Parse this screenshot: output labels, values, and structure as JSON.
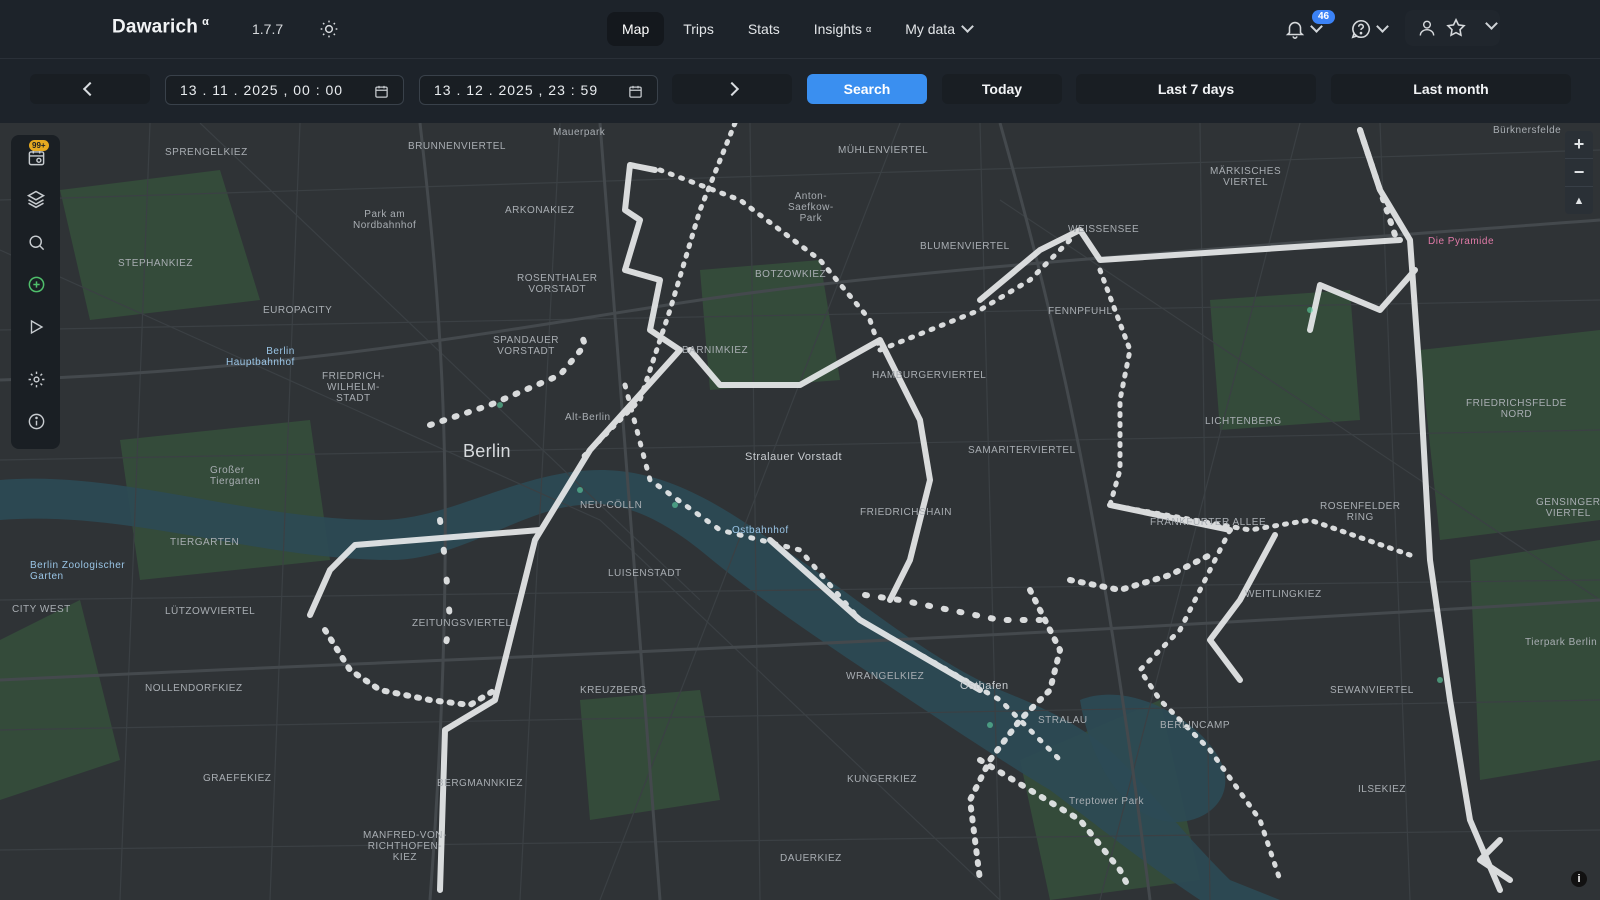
{
  "header": {
    "brand": "Dawarich",
    "brand_sup": "α",
    "version": "1.7.7",
    "nav": [
      {
        "label": "Map",
        "active": true
      },
      {
        "label": "Trips"
      },
      {
        "label": "Stats"
      },
      {
        "label": "Insights",
        "sup": "α"
      },
      {
        "label": "My data",
        "dropdown": true
      }
    ],
    "notifications_count": "46",
    "icons": [
      "sun-icon",
      "bell-icon",
      "help-icon",
      "user-icon",
      "star-icon"
    ]
  },
  "toolbar": {
    "start_datetime": "13 . 11 . 2025 ,  00 : 00",
    "end_datetime": "13 . 12 . 2025 ,  23 : 59",
    "search_label": "Search",
    "today_label": "Today",
    "last7_label": "Last 7 days",
    "lastmonth_label": "Last month"
  },
  "sidebar": {
    "badge": "99+",
    "icons": [
      "calendar-icon",
      "layers-icon",
      "search-icon",
      "add-circle-icon",
      "play-icon",
      "settings-icon",
      "info-icon"
    ]
  },
  "map": {
    "zoom_in": "+",
    "zoom_out": "−",
    "compass": "▲",
    "attribution": "i",
    "labels": {
      "berlin": "Berlin",
      "sprengelkiez": "SPRENGELKIEZ",
      "brunnenviertel": "BRUNNENVIERTEL",
      "muehlenviertel": "MÜHLENVIERTEL",
      "stephankiez": "STEPHANKIEZ",
      "arkonakiez": "ARKONAKIEZ",
      "rosenthaler": "ROSENTHALER\nVORSTADT",
      "botzowkiez": "BOTZOWKIEZ",
      "blumenviertel": "BLUMENVIERTEL",
      "europacity": "EUROPACITY",
      "spandauer": "SPANDAUER\nVORSTADT",
      "barnimkiez": "BARNIMKIEZ",
      "hamburgerviertel": "HAMBURGERVIERTEL",
      "fennpfuhl": "FENNPFUHL",
      "alt_berlin": "Alt-Berlin",
      "friedrich_wilhelm": "FRIEDRICH-\nWILHELM-\nSTADT",
      "stralauer": "Stralauer Vorstadt",
      "samariter": "SAMARITERVIERTEL",
      "lichtenberg": "LICHTENBERG",
      "friedrichshain": "FRIEDRICHSHAIN",
      "frankfurter": "FRANKFURTER ALLEE",
      "rosenfelder": "ROSENFELDER\nRING",
      "neu_coelln": "NEU-CÖLLN",
      "tiergarten": "TIERGARTEN",
      "luisenstadt": "LUISENSTADT",
      "zeitungsviertel": "ZEITUNGSVIERTEL",
      "weitlingkiez": "WEITLINGKIEZ",
      "city_west": "CITY WEST",
      "luetzowviertel": "LÜTZOWVIERTEL",
      "nollendorfkiez": "NOLLENDORFKIEZ",
      "kreuzberg": "KREUZBERG",
      "wrangelkiez": "WRANGELKIEZ",
      "osthafen": "Osthafen",
      "stralau": "STRALAU",
      "berlin_ancam": "BERLINCAMP",
      "sewanviertel": "SEWANVIERTEL",
      "graefekiez": "GRAEFEKIEZ",
      "bergmannkiez": "BERGMANNKIEZ",
      "kungerkiez": "KUNGERKIEZ",
      "ilse": "ILSEKIEZ",
      "treptower_park": "Treptower Park",
      "tierpark": "Tierpark Berlin",
      "zoo": "Berlin Zoologischer\nGarten",
      "hauptbahnhof": "Berlin\nHauptbahnhof",
      "mauerpark": "Mauerpark",
      "anton_saefkow": "Anton-\nSaefkow-\nPark",
      "park_nordbahnhof": "Park am\nNordbahnhof",
      "grosser_tiergarten": "Großer\nTiergarten",
      "ostbahnhof": "Ostbahnhof",
      "pyramide": "Die Pyramide",
      "buerknersfelde": "Bürknersfelde",
      "marzahn": "MÄRKISCHES\nVIERTEL",
      "friedrichsfelde": "FRIEDRICHSFELDE\nNORD",
      "genslerviertel": "GENSINGER\nVIERTEL",
      "dauerkiez": "DAUERKIEZ",
      "manfred": "MANFRED-VON-\nRICHTHOFEN-\nKIEZ",
      "weissensee": "WEISSENSEE"
    }
  }
}
